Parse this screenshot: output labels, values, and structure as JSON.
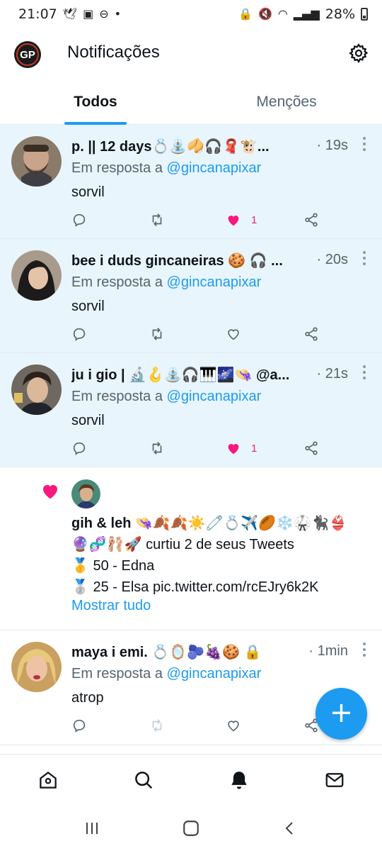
{
  "status_bar": {
    "time": "21:07",
    "battery": "28%",
    "dot": "•"
  },
  "header": {
    "avatar_initials": "GP",
    "title": "Notificações"
  },
  "tabs": [
    {
      "label": "Todos",
      "active": true
    },
    {
      "label": "Menções",
      "active": false
    }
  ],
  "notifications": [
    {
      "type": "reply",
      "name": "p. || 12 days💍⛲🥠🎧🧣🐮...",
      "time": "· 19s",
      "reply_prefix": "Em resposta a ",
      "reply_handle": "@gincanapixar",
      "text": "sorvil",
      "liked": true,
      "like_count": "1",
      "unread": true
    },
    {
      "type": "reply",
      "name": "bee i duds gincaneiras 🍪 🎧 ...",
      "time": "· 20s",
      "reply_prefix": "Em resposta a ",
      "reply_handle": "@gincanapixar",
      "text": "sorvil",
      "liked": false,
      "like_count": "",
      "unread": true
    },
    {
      "type": "reply",
      "name": "ju i gio | 🔬🪝⛲🎧🎹🌌👒 @a...",
      "time": "· 21s",
      "reply_prefix": "Em resposta a ",
      "reply_handle": "@gincanapixar",
      "text": "sorvil",
      "liked": true,
      "like_count": "1",
      "unread": true
    },
    {
      "type": "like",
      "name": "gih & leh",
      "name_emojis": "👒🍂🍂☀️🧷💍✈️🏉❄️🥋🐈‍⬛👙",
      "line2_emojis": "🔮🧬🩰🚀",
      "action": " curtiu 2 de seus Tweets",
      "medal1": "🥇",
      "line3": " 50 - Edna",
      "medal2": "🥈",
      "line4": " 25 - Elsa pic.twitter.com/rcEJry6k2K",
      "show_all": "Mostrar tudo"
    },
    {
      "type": "reply",
      "name": "maya i emi. 💍🪞🫐🍇🍪 🔒",
      "time": "· 1min",
      "reply_prefix": "Em resposta a ",
      "reply_handle": "@gincanapixar",
      "text": "atrop",
      "liked": false,
      "like_count": "",
      "unread": false
    }
  ],
  "fab": {
    "label": "+"
  },
  "colors": {
    "accent": "#1d9bf0",
    "like": "#f91880",
    "unread_bg": "#e8f5fd"
  },
  "bottom_nav": [
    "home-icon",
    "search-icon",
    "bell-icon",
    "mail-icon"
  ],
  "system_nav": [
    "recent-apps",
    "home",
    "back"
  ]
}
